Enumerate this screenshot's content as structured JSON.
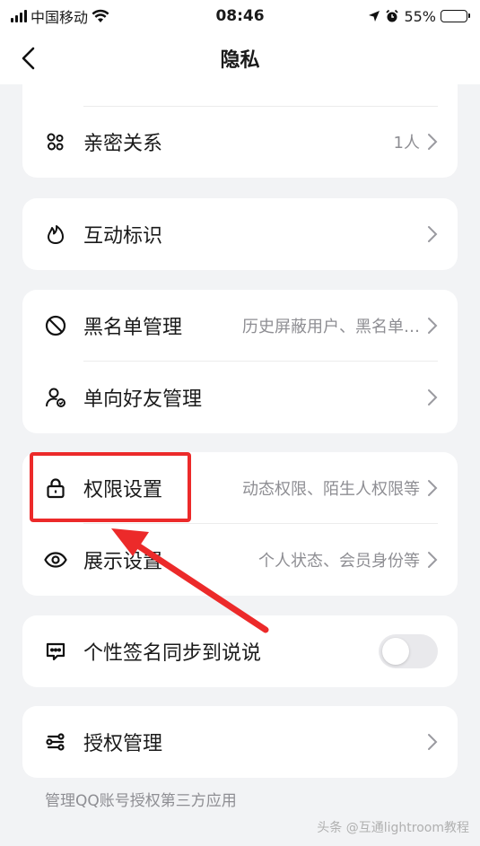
{
  "status_bar": {
    "carrier": "中国移动",
    "time": "08:46",
    "battery": "55%",
    "battery_level": 0.55,
    "icons": [
      "signal-icon",
      "wifi-icon",
      "location-icon",
      "alarm-icon",
      "battery-icon"
    ]
  },
  "nav": {
    "title": "隐私",
    "back_icon": "chevron-left-icon"
  },
  "cards": {
    "intimate": {
      "label": "亲密关系",
      "value": "1人",
      "icon": "intimate-relationship-icon"
    },
    "interaction": {
      "label": "互动标识",
      "value": "",
      "icon": "flame-icon"
    },
    "blacklist": {
      "label": "黑名单管理",
      "value": "历史屏蔽用户、黑名单…",
      "icon": "block-icon"
    },
    "one_way": {
      "label": "单向好友管理",
      "value": "",
      "icon": "one-way-friend-icon"
    },
    "permission": {
      "label": "权限设置",
      "value": "动态权限、陌生人权限等",
      "icon": "lock-icon"
    },
    "display": {
      "label": "展示设置",
      "value": "个人状态、会员身份等",
      "icon": "eye-icon"
    },
    "signature_sync": {
      "label": "个性签名同步到说说",
      "enabled": false,
      "icon": "message-bubble-icon"
    },
    "authorization": {
      "label": "授权管理",
      "value": "",
      "icon": "authorization-icon"
    }
  },
  "footer_note": "管理QQ账号授权第三方应用",
  "watermark": "头条 @互通lightroom教程",
  "colors": {
    "background": "#f2f3f5",
    "card": "#ffffff",
    "secondary_text": "#8e8e93",
    "annotation_red": "#ec2a2a"
  }
}
